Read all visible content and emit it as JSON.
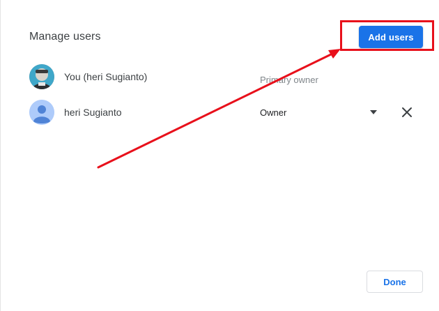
{
  "dialog": {
    "title": "Manage users",
    "add_users_label": "Add users",
    "done_label": "Done"
  },
  "users": [
    {
      "name": "You (heri Sugianto)",
      "role": "Primary owner",
      "avatar": "user-photo",
      "editable": false
    },
    {
      "name": "heri Sugianto",
      "role": "Owner",
      "avatar": "default-person-icon",
      "editable": true
    }
  ],
  "annotation": {
    "color": "#e8101b",
    "arrow": "red-arrow",
    "box": "red-highlight-box"
  },
  "colors": {
    "primary": "#1a73e8",
    "text": "#3c4043",
    "muted": "#80868b",
    "avatar_default_bg": "#aecbfa",
    "avatar_default_fg": "#4f83d6"
  }
}
